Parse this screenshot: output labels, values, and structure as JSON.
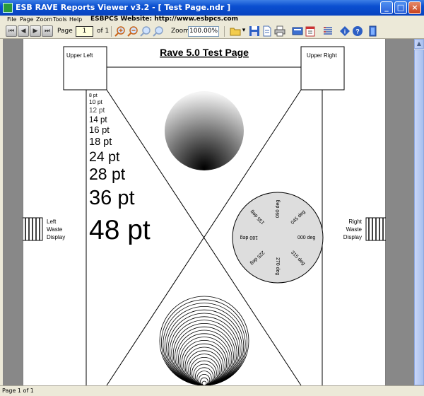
{
  "window": {
    "title": "ESB RAVE Reports Viewer v3.2 - [ Test Page.ndr ]",
    "minimize": "_",
    "maximize": "□",
    "close": "×"
  },
  "menu": [
    "File",
    "Page",
    "Zoom",
    "Tools",
    "Help"
  ],
  "website": "ESBPCS Website: http://www.esbpcs.com",
  "toolbar": {
    "page_label": "Page",
    "page_value": "1",
    "of_label": "of 1",
    "zoom_label": "Zoom",
    "zoom_value": "100.00%"
  },
  "report": {
    "title": "Rave 5.0 Test Page",
    "upper_left": "Upper Left",
    "upper_right": "Upper Right",
    "left_waste": [
      "Left",
      "Waste",
      "Display"
    ],
    "right_waste": [
      "Right",
      "Waste",
      "Display"
    ],
    "font_sizes": [
      "8 pt",
      "10 pt",
      "12 pt",
      "14 pt",
      "16 pt",
      "18 pt",
      "24 pt",
      "28 pt",
      "36 pt",
      "48 pt"
    ],
    "angles": [
      "000 deg",
      "045 deg",
      "090 deg",
      "135 deg",
      "180 deg",
      "225 deg",
      "270 deg",
      "315 deg"
    ]
  },
  "status": "Page 1 of 1"
}
